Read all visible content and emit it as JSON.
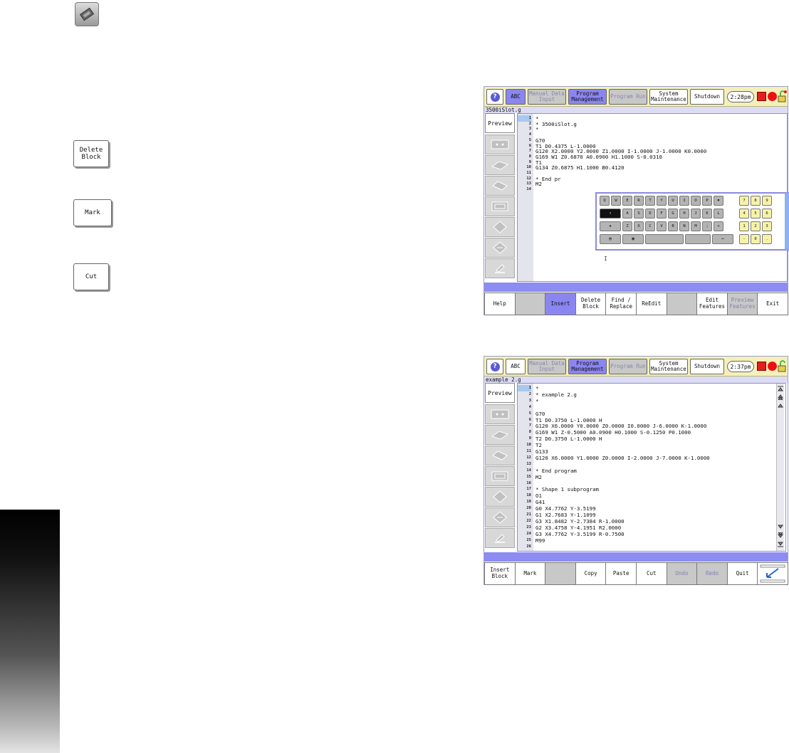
{
  "left_panel": {
    "doc_buttons": [
      {
        "label": "Delete\nBlock"
      },
      {
        "label": "Mark"
      },
      {
        "label": "Cut"
      }
    ]
  },
  "screen1": {
    "topbar": {
      "abc": "ABC",
      "manual": "Manual Data\nInput",
      "program_mgmt": "Program\nManagement",
      "program_run": "Program Run",
      "system": "System\nMaintenance",
      "shutdown": "Shutdown",
      "clock": "2:28pm"
    },
    "filename": "3500iSlot.g",
    "preview": "Preview",
    "lines": [
      {
        "n": "1",
        "t": "*"
      },
      {
        "n": "2",
        "t": "* 3500iSlot.g"
      },
      {
        "n": "3",
        "t": "*"
      },
      {
        "n": "4",
        "t": ""
      },
      {
        "n": "5",
        "t": "G70"
      },
      {
        "n": "6",
        "t": "T1 D0.4375 L-1.0000"
      },
      {
        "n": "7",
        "t": "G120 X2.0000 Y2.0000 Z1.0000 I-1.0000 J-1.0000 K0.0000"
      },
      {
        "n": "8",
        "t": "G169 W1 Z0.6870 A0.0900 H1.1000 S-0.0310"
      },
      {
        "n": "9",
        "t": "T1"
      },
      {
        "n": "10",
        "t": "G134 Z0.6875 H1.1000 B0.4120"
      },
      {
        "n": "11",
        "t": ""
      },
      {
        "n": "12",
        "t": "* End pr"
      },
      {
        "n": "13",
        "t": "M2"
      },
      {
        "n": "14",
        "t": ""
      }
    ],
    "keyboard": {
      "row1": [
        "Q",
        "W",
        "E",
        "R",
        "T",
        "Y",
        "U",
        "I",
        "O",
        "P"
      ],
      "row2": [
        "A",
        "S",
        "D",
        "F",
        "G",
        "H",
        "J",
        "K",
        "L"
      ],
      "row3": [
        "Z",
        "X",
        "C",
        "V",
        "B",
        "N",
        "M",
        ";",
        "+"
      ],
      "symbols": "(*+\\)",
      "numpad_row1": [
        "7",
        "8",
        "9"
      ],
      "numpad_row2": [
        "4",
        "5",
        "6"
      ],
      "numpad_row3": [
        "1",
        "2",
        "3"
      ],
      "numpad_row4": [
        "-",
        "0",
        "."
      ]
    },
    "softkeys": [
      "Help",
      "",
      "Insert",
      "Delete\nBlock",
      "Find /\nReplace",
      "ReEdit",
      "",
      "Edit\nFeatures",
      "Preview\nFeatures",
      "Exit"
    ]
  },
  "screen2": {
    "topbar": {
      "abc": "ABC",
      "manual": "Manual Data\nInput",
      "program_mgmt": "Program\nManagement",
      "program_run": "Program Run",
      "system": "System\nMaintenance",
      "shutdown": "Shutdown",
      "clock": "2:37pm"
    },
    "filename": "example 2.g",
    "preview": "Preview",
    "lines": [
      {
        "n": "1",
        "t": "*"
      },
      {
        "n": "2",
        "t": "* example 2.g"
      },
      {
        "n": "3",
        "t": "*"
      },
      {
        "n": "4",
        "t": ""
      },
      {
        "n": "5",
        "t": "G70"
      },
      {
        "n": "6",
        "t": "T1 D0.3750 L-1.0000 H"
      },
      {
        "n": "7",
        "t": "G120 X6.0000 Y0.0000 Z0.0000 I0.0000 J-6.0000 K-1.0000"
      },
      {
        "n": "8",
        "t": "G169 W1 Z-0.5000 A0.0900 H0.1000 S-0.1250 P0.1000"
      },
      {
        "n": "9",
        "t": "T2 D0.3750 L-1.0000 H"
      },
      {
        "n": "10",
        "t": "T2"
      },
      {
        "n": "11",
        "t": "G133"
      },
      {
        "n": "12",
        "t": "G120 X6.0000 Y1.0000 Z0.0000 I-2.0000 J-7.0000 K-1.0000"
      },
      {
        "n": "13",
        "t": ""
      },
      {
        "n": "14",
        "t": "* End program"
      },
      {
        "n": "15",
        "t": "M2"
      },
      {
        "n": "16",
        "t": ""
      },
      {
        "n": "17",
        "t": "* Shape 1 subprogram"
      },
      {
        "n": "18",
        "t": "O1"
      },
      {
        "n": "19",
        "t": "G41"
      },
      {
        "n": "20",
        "t": "G0 X4.7762 Y-3.5199"
      },
      {
        "n": "21",
        "t": "G1 X2.7683 Y-1.1099"
      },
      {
        "n": "22",
        "t": "G3 X1.8482 Y-2.7384 R-1.0000"
      },
      {
        "n": "23",
        "t": "G2 X3.4758 Y-4.1951 R2.0000"
      },
      {
        "n": "24",
        "t": "G3 X4.7762 Y-3.5199 R-0.7500"
      },
      {
        "n": "25",
        "t": "M99"
      },
      {
        "n": "26",
        "t": ""
      }
    ],
    "softkeys": [
      "Insert\nBlock",
      "Mark",
      "",
      "Copy",
      "Paste",
      "Cut",
      "Undo",
      "Redo",
      "Quit",
      ""
    ]
  }
}
